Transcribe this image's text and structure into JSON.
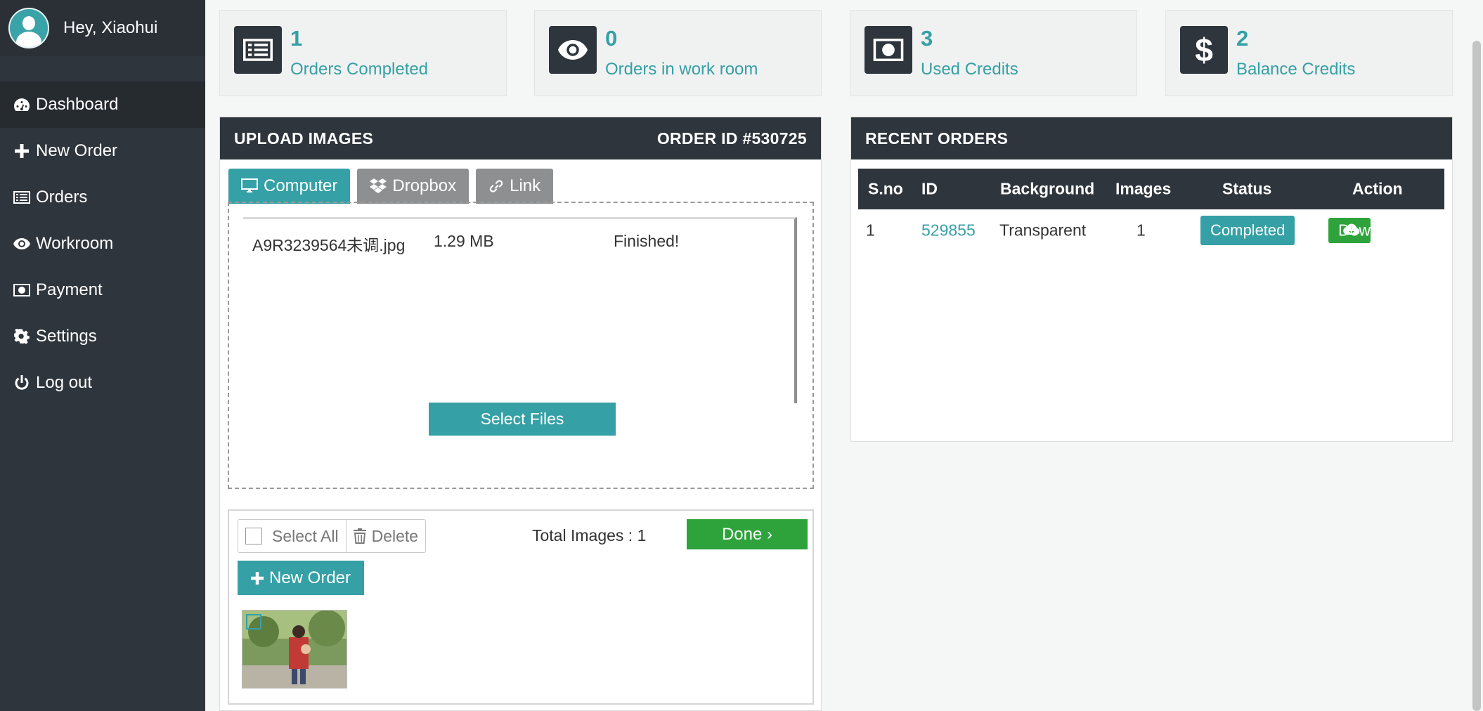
{
  "user": {
    "greeting": "Hey, Xiaohui"
  },
  "sidebar": {
    "items": [
      {
        "label": "Dashboard",
        "icon": "dashboard-icon",
        "active": true
      },
      {
        "label": "New Order",
        "icon": "plus-icon"
      },
      {
        "label": "Orders",
        "icon": "list-icon"
      },
      {
        "label": "Workroom",
        "icon": "eye-icon"
      },
      {
        "label": "Payment",
        "icon": "money-icon"
      },
      {
        "label": "Settings",
        "icon": "gear-icon"
      },
      {
        "label": "Log out",
        "icon": "power-icon"
      }
    ]
  },
  "stats": [
    {
      "value": "1",
      "label": "Orders Completed",
      "icon": "list-icon"
    },
    {
      "value": "0",
      "label": "Orders in work room",
      "icon": "eye-icon"
    },
    {
      "value": "3",
      "label": "Used Credits",
      "icon": "money-icon"
    },
    {
      "value": "2",
      "label": "Balance Credits",
      "icon": "dollar-icon"
    }
  ],
  "upload": {
    "title": "UPLOAD IMAGES",
    "order_id": "ORDER ID #530725",
    "tabs": [
      "Computer",
      "Dropbox",
      "Link"
    ],
    "file": {
      "name": "A9R3239564未调.jpg",
      "size": "1.29 MB",
      "status": "Finished!"
    },
    "select_files": "Select Files",
    "select_all": "Select All",
    "delete": "Delete",
    "total_images": "Total Images : 1",
    "done": "Done  ›",
    "new_order": "New Order"
  },
  "recent": {
    "title": "RECENT ORDERS",
    "columns": [
      "S.no",
      "ID",
      "Background",
      "Images",
      "Status",
      "Action"
    ],
    "rows": [
      {
        "sno": "1",
        "id": "529855",
        "background": "Transparent",
        "images": "1",
        "status": "Completed",
        "action": "Download"
      }
    ]
  },
  "colors": {
    "teal": "#35a0a5",
    "dark": "#2f353c",
    "green": "#2ea33b"
  }
}
